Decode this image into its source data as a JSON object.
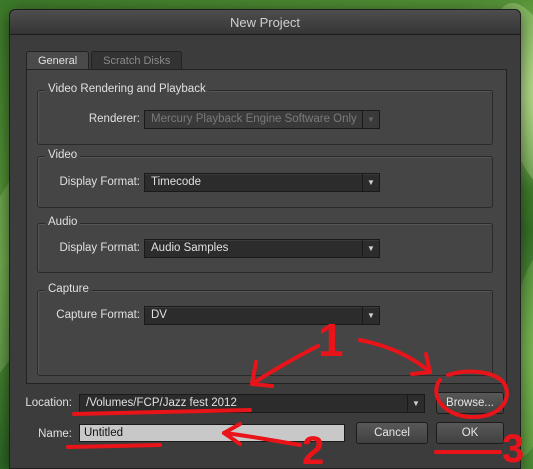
{
  "dialog": {
    "title": "New Project",
    "tabs": [
      {
        "label": "General",
        "active": true
      },
      {
        "label": "Scratch Disks",
        "active": false
      }
    ],
    "sections": {
      "video_rendering": {
        "title": "Video Rendering and Playback",
        "renderer_label": "Renderer:",
        "renderer_value": "Mercury Playback Engine Software Only"
      },
      "video": {
        "title": "Video",
        "display_format_label": "Display Format:",
        "display_format_value": "Timecode"
      },
      "audio": {
        "title": "Audio",
        "display_format_label": "Display Format:",
        "display_format_value": "Audio Samples"
      },
      "capture": {
        "title": "Capture",
        "capture_format_label": "Capture Format:",
        "capture_format_value": "DV"
      }
    },
    "location": {
      "label": "Location:",
      "value": "/Volumes/FCP/Jazz fest 2012",
      "browse_label": "Browse..."
    },
    "name": {
      "label": "Name:",
      "value": "Untitled"
    },
    "buttons": {
      "cancel": "Cancel",
      "ok": "OK"
    }
  },
  "annotations": {
    "numbers": [
      "1",
      "2",
      "3"
    ],
    "ink_color": "#e8141a"
  },
  "icons": {
    "dropdown": "chevron-down-icon"
  }
}
